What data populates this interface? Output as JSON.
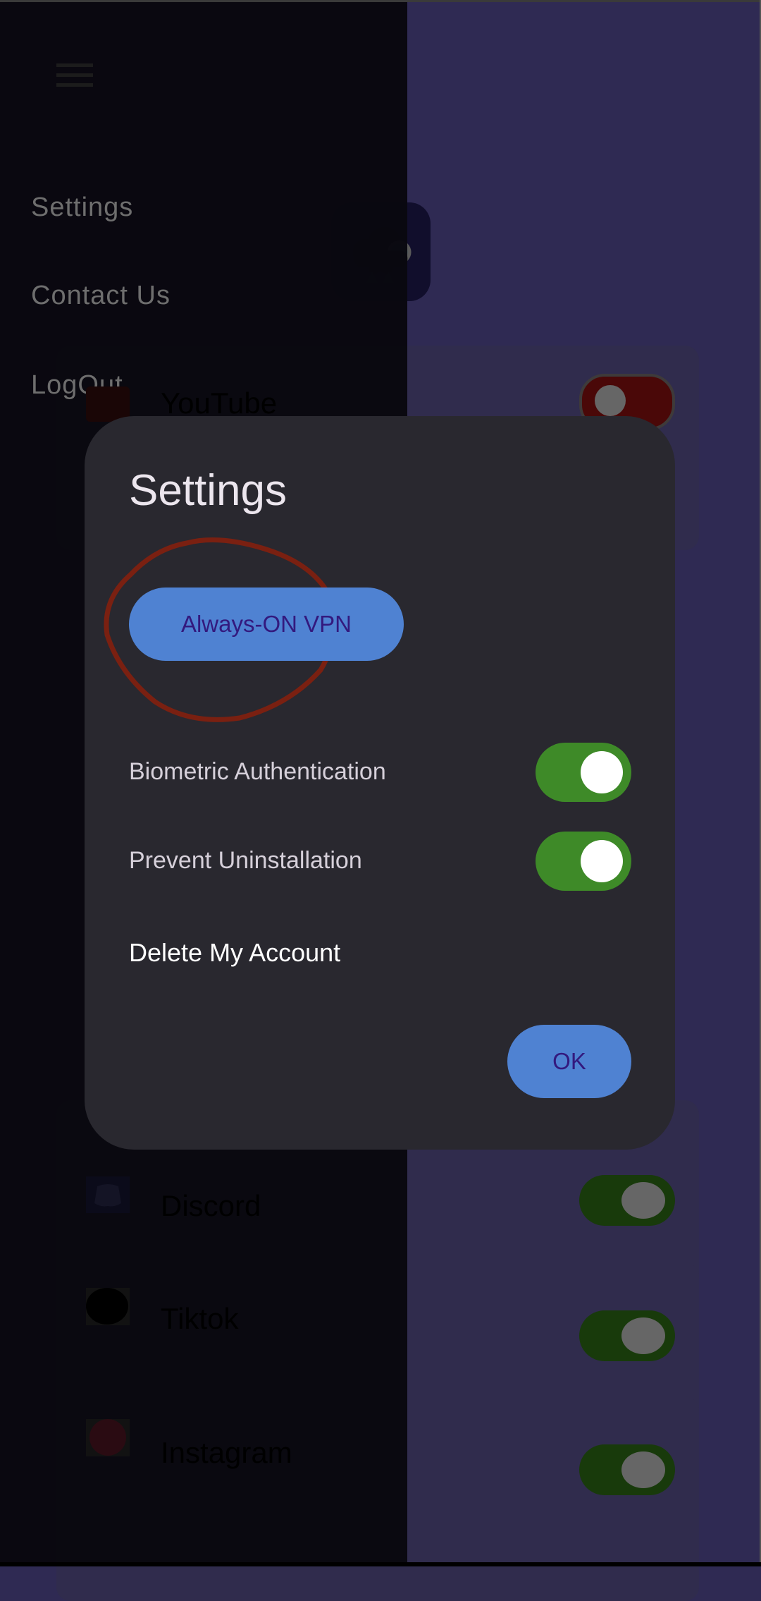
{
  "drawer": {
    "menu_icon": "hamburger-icon",
    "items": [
      {
        "label": "Settings"
      },
      {
        "label": "Contact Us"
      },
      {
        "label": "LogOut"
      }
    ]
  },
  "app_list": [
    {
      "name": "YouTube",
      "icon": "youtube-icon",
      "enabled": false
    },
    {
      "name": "Discord",
      "icon": "discord-icon",
      "enabled": true
    },
    {
      "name": "Tiktok",
      "icon": "tiktok-icon",
      "enabled": true
    },
    {
      "name": "Instagram",
      "icon": "instagram-icon",
      "enabled": true
    }
  ],
  "dialog": {
    "title": "Settings",
    "vpn_button": "Always-ON VPN",
    "options": [
      {
        "label": "Biometric Authentication",
        "enabled": true
      },
      {
        "label": "Prevent Uninstallation",
        "enabled": true
      }
    ],
    "delete_account": "Delete My Account",
    "ok_button": "OK"
  },
  "colors": {
    "background": "#2f2a53",
    "drawer": "#09080f",
    "dialog": "#29282f",
    "button": "#4f82d2",
    "button_text": "#33197e",
    "toggle_on": "#3e8a28",
    "annotation": "#7a2011"
  }
}
